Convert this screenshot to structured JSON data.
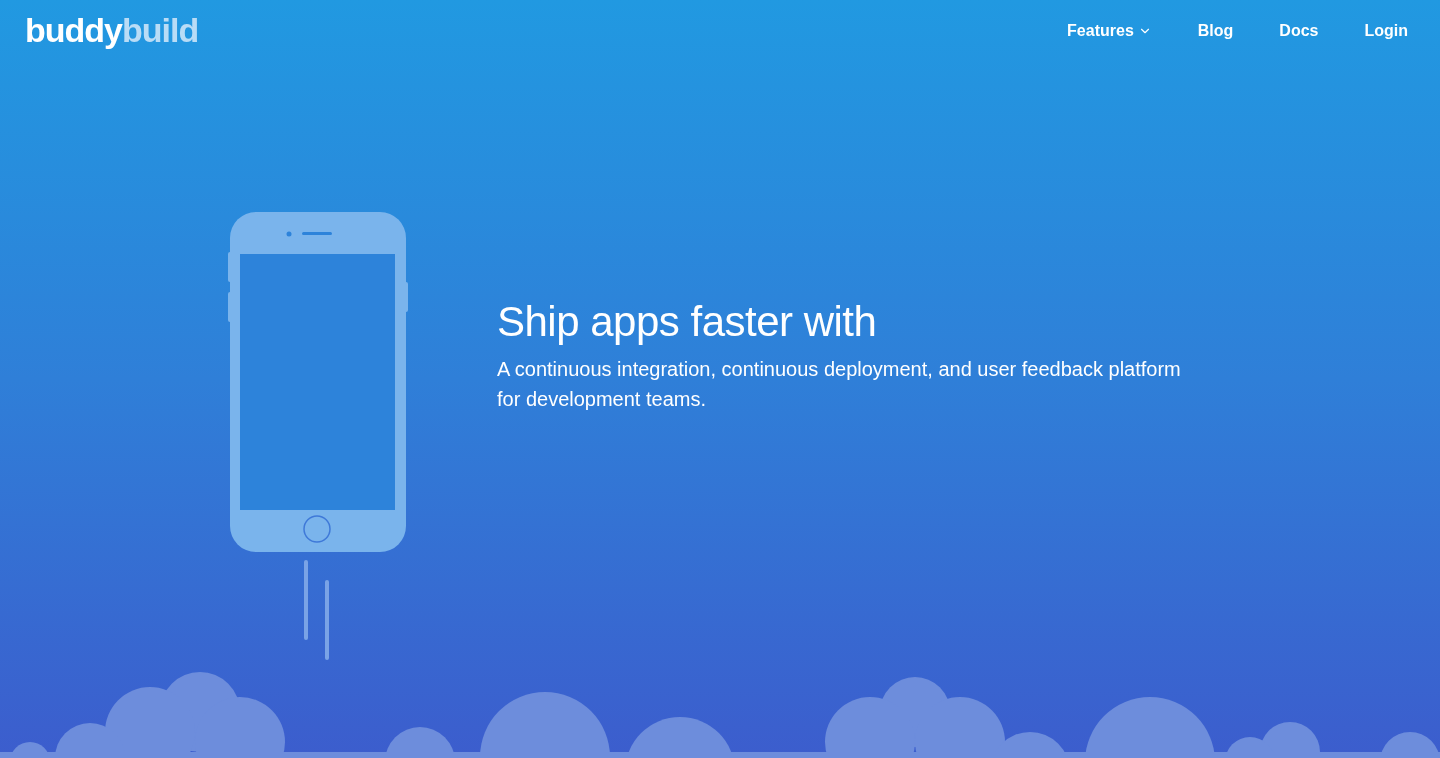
{
  "logo": {
    "part_1": "buddy",
    "part_2": "build"
  },
  "nav": [
    {
      "label": "Features",
      "kind": "dropdown"
    },
    {
      "label": "Blog",
      "kind": "link"
    },
    {
      "label": "Docs",
      "kind": "link"
    },
    {
      "label": "Login",
      "kind": "link"
    }
  ],
  "hero": {
    "title": "Ship apps faster with",
    "subtitle": "A continuous integration, continuous deployment, and user feedback platform for development teams."
  }
}
